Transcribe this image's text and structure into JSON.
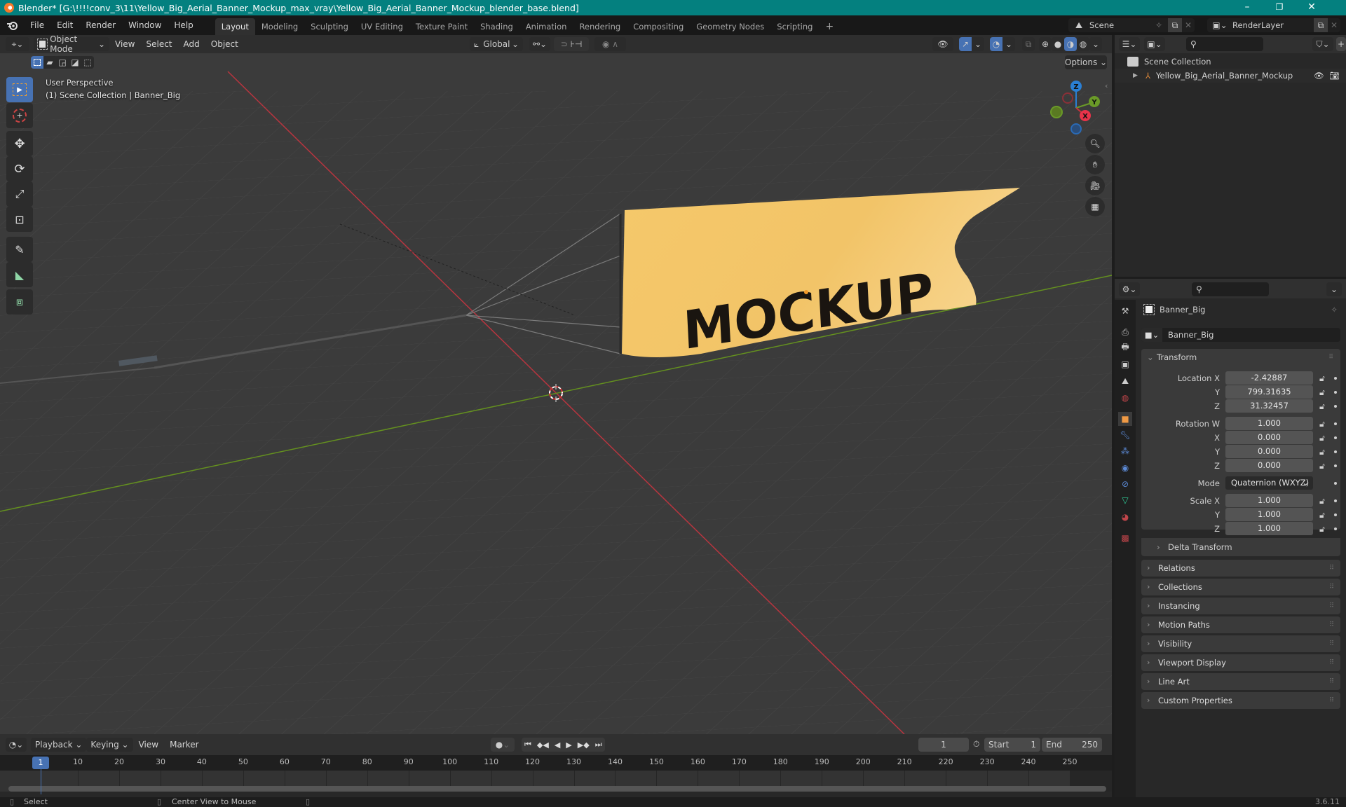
{
  "window": {
    "title": "Blender* [G:\\!!!!conv_3\\11\\Yellow_Big_Aerial_Banner_Mockup_max_vray\\Yellow_Big_Aerial_Banner_Mockup_blender_base.blend]",
    "controls": {
      "minimize": "–",
      "maximize": "❐",
      "close": "✕"
    }
  },
  "menubar": {
    "items": [
      "File",
      "Edit",
      "Render",
      "Window",
      "Help"
    ],
    "workspaces": [
      "Layout",
      "Modeling",
      "Sculpting",
      "UV Editing",
      "Texture Paint",
      "Shading",
      "Animation",
      "Rendering",
      "Compositing",
      "Geometry Nodes",
      "Scripting"
    ],
    "active_workspace": "Layout",
    "add_workspace": "+",
    "scene": "Scene",
    "view_layer": "RenderLayer"
  },
  "viewport": {
    "mode": "Object Mode",
    "menus": [
      "View",
      "Select",
      "Add",
      "Object"
    ],
    "orientation": "Global",
    "options_label": "Options",
    "overlay_line1": "User Perspective",
    "overlay_line2": "(1) Scene Collection | Banner_Big",
    "banner_text": "MOCKUP",
    "colors": {
      "banner": "#f5c86a",
      "x_axis": "#c8323c",
      "y_axis": "#6a9a28",
      "z_axis": "#2a7fd4",
      "accent": "#4772b3"
    },
    "gizmo": {
      "x": "X",
      "y": "Y",
      "z": "Z"
    }
  },
  "outliner": {
    "root": "Scene Collection",
    "items": [
      {
        "name": "Yellow_Big_Aerial_Banner_Mockup",
        "type": "empty"
      }
    ]
  },
  "properties": {
    "object_name": "Banner_Big",
    "datablock_name": "Banner_Big",
    "transform": {
      "title": "Transform",
      "location": {
        "label": "Location X",
        "x": "-2.42887",
        "y": "799.31635",
        "z": "31.32457"
      },
      "rotation": {
        "label": "Rotation W",
        "w": "1.000",
        "x": "0.000",
        "y": "0.000",
        "z": "0.000"
      },
      "mode_label": "Mode",
      "mode_value": "Quaternion (WXYZ)",
      "scale": {
        "label": "Scale X",
        "x": "1.000",
        "y": "1.000",
        "z": "1.000"
      },
      "axis_labels": {
        "y": "Y",
        "z": "Z",
        "x": "X"
      },
      "delta": "Delta Transform"
    },
    "panels": [
      "Relations",
      "Collections",
      "Instancing",
      "Motion Paths",
      "Visibility",
      "Viewport Display",
      "Line Art",
      "Custom Properties"
    ]
  },
  "timeline": {
    "menus": [
      "Playback",
      "Keying",
      "View",
      "Marker"
    ],
    "current_frame": "1",
    "start_label": "Start",
    "start": "1",
    "end_label": "End",
    "end": "250",
    "ruler": [
      "10",
      "20",
      "30",
      "40",
      "50",
      "60",
      "70",
      "80",
      "90",
      "100",
      "110",
      "120",
      "130",
      "140",
      "150",
      "160",
      "170",
      "180",
      "190",
      "200",
      "210",
      "220",
      "230",
      "240",
      "250"
    ],
    "playhead": "1"
  },
  "statusbar": {
    "left": "Select",
    "middle": "Center View to Mouse",
    "version": "3.6.11"
  }
}
